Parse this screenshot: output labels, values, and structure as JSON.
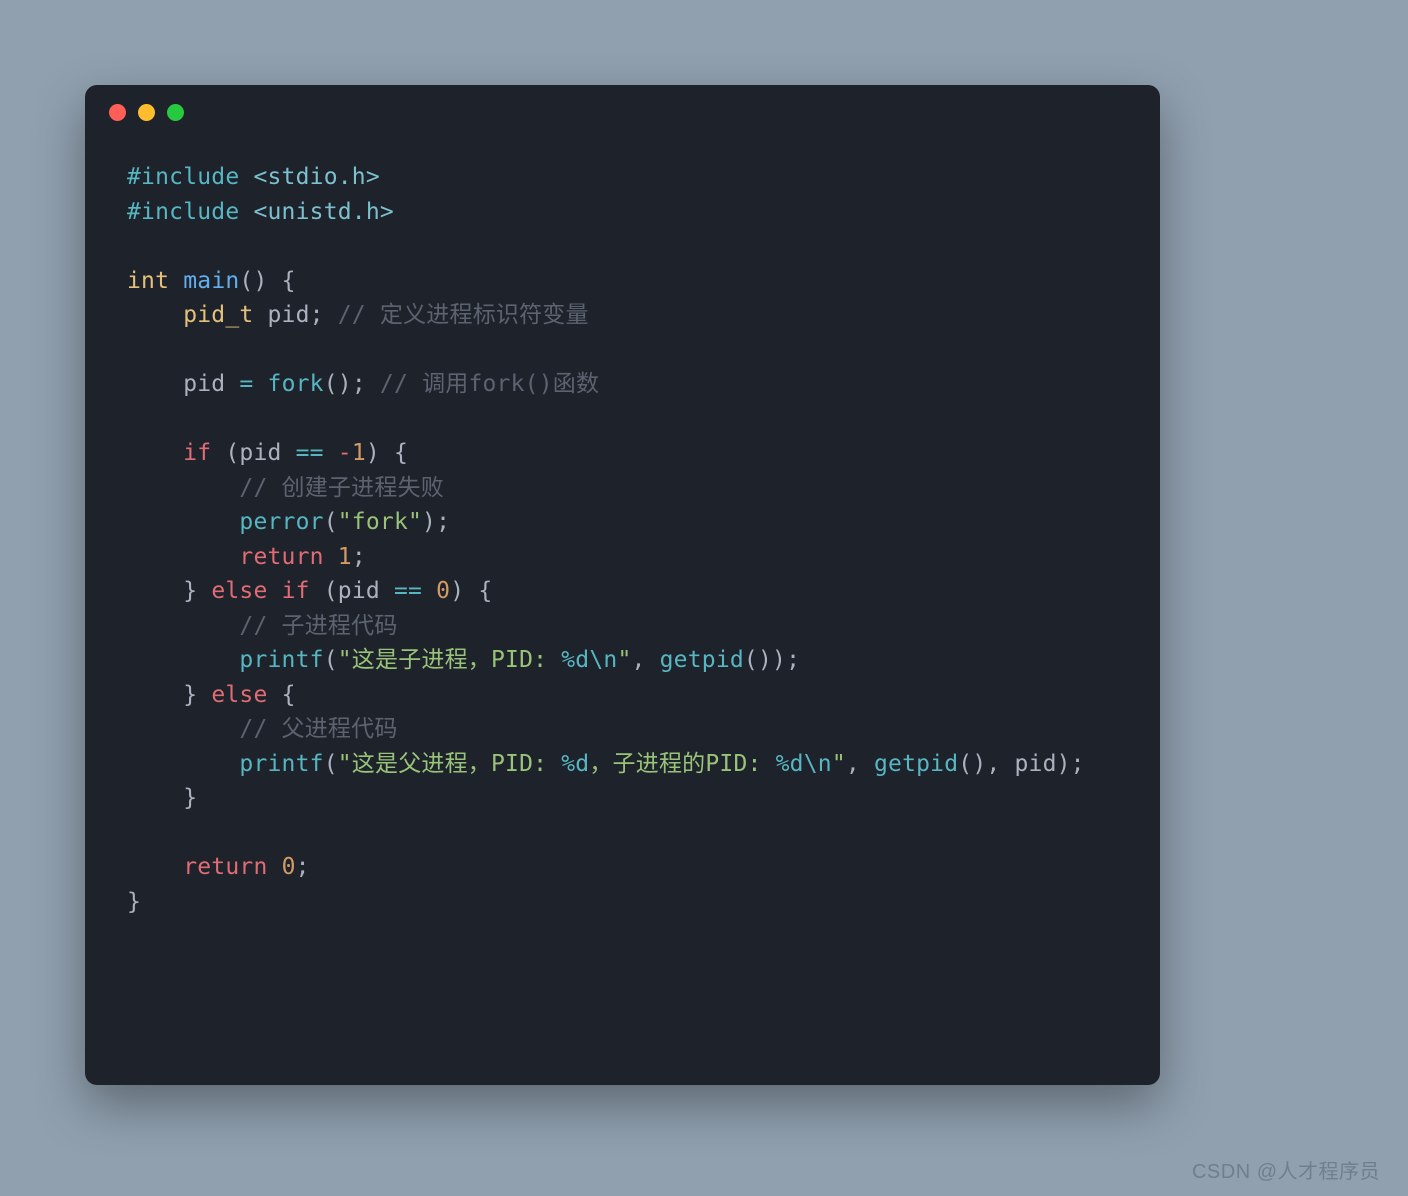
{
  "window": {
    "dot_colors": {
      "red": "#ff5f56",
      "yellow": "#ffbd2e",
      "green": "#27c93f"
    }
  },
  "code": {
    "lines": [
      {
        "tokens": [
          {
            "cls": "tok-pp",
            "t": "#include"
          },
          {
            "cls": "tok-var",
            "t": " "
          },
          {
            "cls": "tok-inc",
            "t": "<stdio.h>"
          }
        ]
      },
      {
        "tokens": [
          {
            "cls": "tok-pp",
            "t": "#include"
          },
          {
            "cls": "tok-var",
            "t": " "
          },
          {
            "cls": "tok-inc",
            "t": "<unistd.h>"
          }
        ]
      },
      {
        "tokens": []
      },
      {
        "tokens": [
          {
            "cls": "tok-type",
            "t": "int"
          },
          {
            "cls": "tok-var",
            "t": " "
          },
          {
            "cls": "tok-fn2",
            "t": "main"
          },
          {
            "cls": "tok-punc",
            "t": "() {"
          }
        ]
      },
      {
        "tokens": [
          {
            "cls": "tok-var",
            "t": "    "
          },
          {
            "cls": "tok-type",
            "t": "pid_t"
          },
          {
            "cls": "tok-var",
            "t": " pid; "
          },
          {
            "cls": "tok-cmt",
            "t": "// 定义进程标识符变量"
          }
        ]
      },
      {
        "tokens": []
      },
      {
        "tokens": [
          {
            "cls": "tok-var",
            "t": "    pid "
          },
          {
            "cls": "tok-op",
            "t": "="
          },
          {
            "cls": "tok-var",
            "t": " "
          },
          {
            "cls": "tok-fn",
            "t": "fork"
          },
          {
            "cls": "tok-punc",
            "t": "(); "
          },
          {
            "cls": "tok-cmt",
            "t": "// 调用fork()函数"
          }
        ]
      },
      {
        "tokens": []
      },
      {
        "tokens": [
          {
            "cls": "tok-var",
            "t": "    "
          },
          {
            "cls": "tok-kw",
            "t": "if"
          },
          {
            "cls": "tok-var",
            "t": " (pid "
          },
          {
            "cls": "tok-op",
            "t": "=="
          },
          {
            "cls": "tok-var",
            "t": " "
          },
          {
            "cls": "tok-neg",
            "t": "-"
          },
          {
            "cls": "tok-num",
            "t": "1"
          },
          {
            "cls": "tok-punc",
            "t": ") {"
          }
        ]
      },
      {
        "tokens": [
          {
            "cls": "tok-var",
            "t": "        "
          },
          {
            "cls": "tok-cmt",
            "t": "// 创建子进程失败"
          }
        ]
      },
      {
        "tokens": [
          {
            "cls": "tok-var",
            "t": "        "
          },
          {
            "cls": "tok-fn",
            "t": "perror"
          },
          {
            "cls": "tok-punc",
            "t": "("
          },
          {
            "cls": "tok-str",
            "t": "\"fork\""
          },
          {
            "cls": "tok-punc",
            "t": ");"
          }
        ]
      },
      {
        "tokens": [
          {
            "cls": "tok-var",
            "t": "        "
          },
          {
            "cls": "tok-kw",
            "t": "return"
          },
          {
            "cls": "tok-var",
            "t": " "
          },
          {
            "cls": "tok-num",
            "t": "1"
          },
          {
            "cls": "tok-punc",
            "t": ";"
          }
        ]
      },
      {
        "tokens": [
          {
            "cls": "tok-var",
            "t": "    "
          },
          {
            "cls": "tok-punc",
            "t": "} "
          },
          {
            "cls": "tok-kw",
            "t": "else"
          },
          {
            "cls": "tok-var",
            "t": " "
          },
          {
            "cls": "tok-kw",
            "t": "if"
          },
          {
            "cls": "tok-var",
            "t": " (pid "
          },
          {
            "cls": "tok-op",
            "t": "=="
          },
          {
            "cls": "tok-var",
            "t": " "
          },
          {
            "cls": "tok-num",
            "t": "0"
          },
          {
            "cls": "tok-punc",
            "t": ") {"
          }
        ]
      },
      {
        "tokens": [
          {
            "cls": "tok-var",
            "t": "        "
          },
          {
            "cls": "tok-cmt",
            "t": "// 子进程代码"
          }
        ]
      },
      {
        "tokens": [
          {
            "cls": "tok-var",
            "t": "        "
          },
          {
            "cls": "tok-fn",
            "t": "printf"
          },
          {
            "cls": "tok-punc",
            "t": "("
          },
          {
            "cls": "tok-str",
            "t": "\"这是子进程，PID: "
          },
          {
            "cls": "tok-esc",
            "t": "%d"
          },
          {
            "cls": "tok-esc",
            "t": "\\n"
          },
          {
            "cls": "tok-str",
            "t": "\""
          },
          {
            "cls": "tok-punc",
            "t": ", "
          },
          {
            "cls": "tok-fn",
            "t": "getpid"
          },
          {
            "cls": "tok-punc",
            "t": "());"
          }
        ]
      },
      {
        "tokens": [
          {
            "cls": "tok-var",
            "t": "    "
          },
          {
            "cls": "tok-punc",
            "t": "} "
          },
          {
            "cls": "tok-kw",
            "t": "else"
          },
          {
            "cls": "tok-punc",
            "t": " {"
          }
        ]
      },
      {
        "tokens": [
          {
            "cls": "tok-var",
            "t": "        "
          },
          {
            "cls": "tok-cmt",
            "t": "// 父进程代码"
          }
        ]
      },
      {
        "tokens": [
          {
            "cls": "tok-var",
            "t": "        "
          },
          {
            "cls": "tok-fn",
            "t": "printf"
          },
          {
            "cls": "tok-punc",
            "t": "("
          },
          {
            "cls": "tok-str",
            "t": "\"这是父进程，PID: "
          },
          {
            "cls": "tok-esc",
            "t": "%d"
          },
          {
            "cls": "tok-str",
            "t": "，子进程的PID: "
          },
          {
            "cls": "tok-esc",
            "t": "%d"
          },
          {
            "cls": "tok-esc",
            "t": "\\n"
          },
          {
            "cls": "tok-str",
            "t": "\""
          },
          {
            "cls": "tok-punc",
            "t": ", "
          },
          {
            "cls": "tok-fn",
            "t": "getpid"
          },
          {
            "cls": "tok-punc",
            "t": "(), pid);"
          }
        ]
      },
      {
        "tokens": [
          {
            "cls": "tok-var",
            "t": "    "
          },
          {
            "cls": "tok-punc",
            "t": "}"
          }
        ]
      },
      {
        "tokens": []
      },
      {
        "tokens": [
          {
            "cls": "tok-var",
            "t": "    "
          },
          {
            "cls": "tok-kw",
            "t": "return"
          },
          {
            "cls": "tok-var",
            "t": " "
          },
          {
            "cls": "tok-num",
            "t": "0"
          },
          {
            "cls": "tok-punc",
            "t": ";"
          }
        ]
      },
      {
        "tokens": [
          {
            "cls": "tok-punc",
            "t": "}"
          }
        ]
      }
    ]
  },
  "watermark": "CSDN @人才程序员"
}
